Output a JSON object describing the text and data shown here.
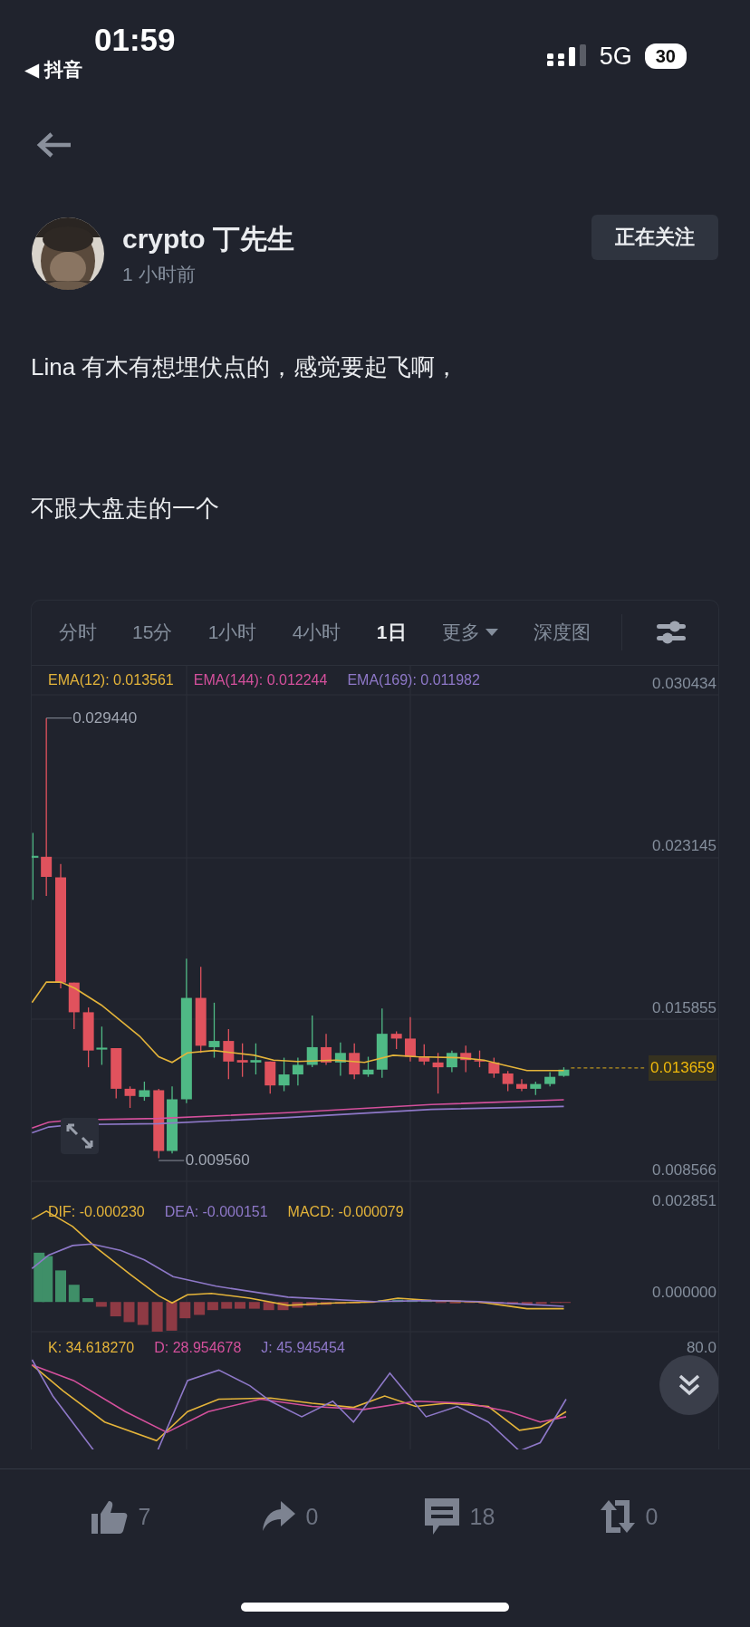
{
  "status_bar": {
    "time": "01:59",
    "back_app": "◀ 抖音",
    "network": "5G",
    "battery": "30"
  },
  "author": {
    "name": "crypto 丁先生",
    "time": "1 小时前",
    "follow_button": "正在关注"
  },
  "post": {
    "paragraphs": [
      "Lina 有木有想埋伏点的，感觉要起飞啊，",
      "不跟大盘走的一个"
    ]
  },
  "chart": {
    "tabs": [
      {
        "label": "分时",
        "selected": false
      },
      {
        "label": "15分",
        "selected": false
      },
      {
        "label": "1小时",
        "selected": false
      },
      {
        "label": "4小时",
        "selected": false
      },
      {
        "label": "1日",
        "selected": true
      },
      {
        "label": "更多",
        "selected": false,
        "caret": true
      },
      {
        "label": "深度图",
        "selected": false
      }
    ],
    "ema_legend": [
      {
        "text": "EMA(12): 0.013561",
        "color": "#e4b43a"
      },
      {
        "text": "EMA(144): 0.012244",
        "color": "#d4509c"
      },
      {
        "text": "EMA(169): 0.011982",
        "color": "#8e78c8"
      }
    ],
    "price_ticks": [
      "0.030434",
      "0.023145",
      "0.015855",
      "0.008566"
    ],
    "high_label": "0.029440",
    "low_label": "0.009560",
    "last_price": "0.013659",
    "macd_legend": [
      {
        "text": "DIF: -0.000230",
        "color": "#e4b43a"
      },
      {
        "text": "DEA: -0.000151",
        "color": "#8e78c8"
      },
      {
        "text": "MACD: -0.000079",
        "color": "#e4b43a"
      }
    ],
    "macd_ticks": [
      "0.002851",
      "0.000000"
    ],
    "kdj_legend": [
      {
        "text": "K: 34.618270",
        "color": "#e4b43a"
      },
      {
        "text": "D: 28.954678",
        "color": "#d4509c"
      },
      {
        "text": "J: 45.945454",
        "color": "#8e78c8"
      }
    ],
    "kdj_ticks": [
      "80.0"
    ]
  },
  "actions": [
    {
      "kind": "like",
      "count": "7"
    },
    {
      "kind": "share",
      "count": "0"
    },
    {
      "kind": "comment",
      "count": "18"
    },
    {
      "kind": "repost",
      "count": "0"
    }
  ]
}
